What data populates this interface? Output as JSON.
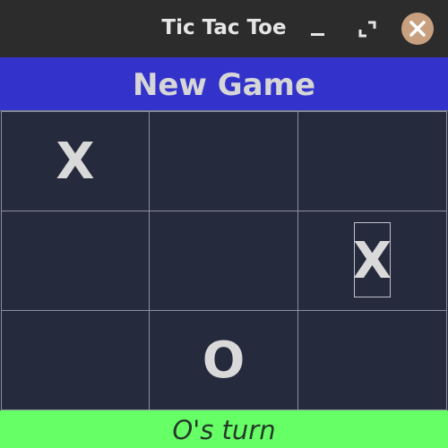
{
  "window": {
    "title": "Tic Tac Toe",
    "controls": [
      "minimize-icon",
      "maximize-icon",
      "close-icon"
    ],
    "close_button_color": "#c9a07f"
  },
  "toolbar": {
    "new_game_label": "New Game",
    "new_game_color": "#3333cc"
  },
  "board": {
    "cells": [
      [
        "X",
        "",
        ""
      ],
      [
        "",
        "",
        "X"
      ],
      [
        "",
        "O",
        ""
      ]
    ],
    "focused_cell": "row 2, column 3",
    "background_color": "#262a3d"
  },
  "status": {
    "text": "O's turn",
    "color": "#66ff66"
  }
}
